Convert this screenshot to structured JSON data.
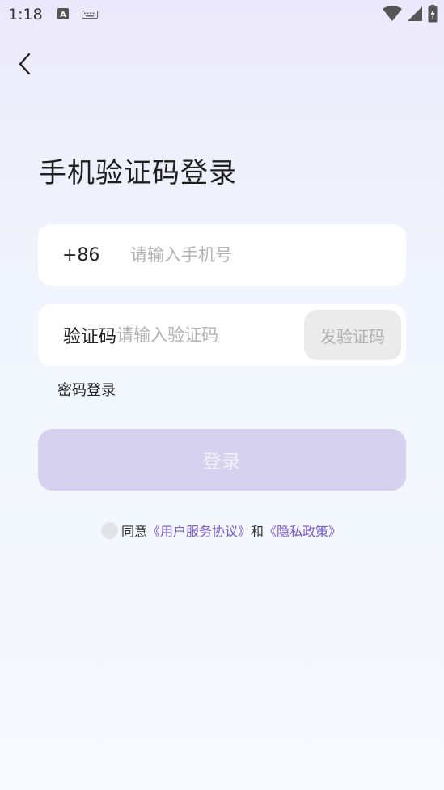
{
  "status_bar": {
    "time": "1:18",
    "icons": [
      "font-a-icon",
      "keyboard-icon",
      "wifi-icon",
      "cell-signal-icon",
      "battery-charging-icon"
    ]
  },
  "header": {
    "back_icon": "chevron-left-icon",
    "title": "手机验证码登录"
  },
  "phone_field": {
    "prefix": "+86",
    "placeholder": "请输入手机号",
    "value": ""
  },
  "code_field": {
    "label": "验证码",
    "placeholder": "请输入验证码",
    "value": "",
    "send_button": "发验证码"
  },
  "password_login_link": "密码登录",
  "login_button": "登录",
  "agreement": {
    "checked": false,
    "prefix": "同意",
    "terms_link": "《用户服务协议》",
    "conjunction": "和",
    "privacy_link": "《隐私政策》"
  },
  "colors": {
    "accent_link": "#7a58cf",
    "login_button_disabled": "#d6d1ef",
    "send_button_bg": "#ebebeb"
  }
}
